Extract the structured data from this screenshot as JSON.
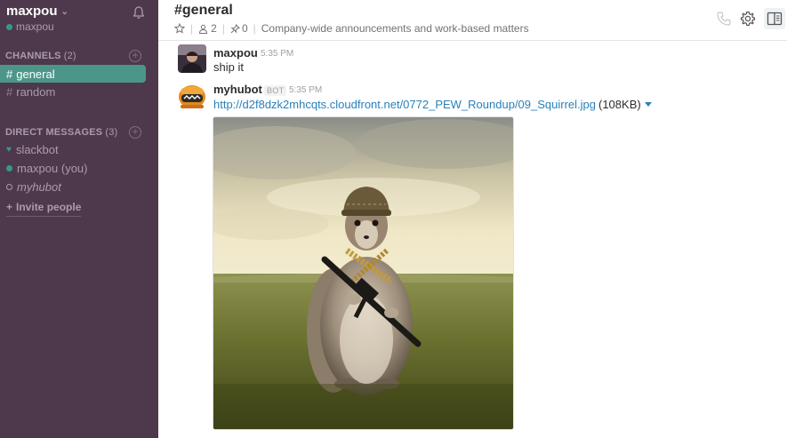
{
  "team": {
    "name": "maxpou",
    "user": "maxpou"
  },
  "channels": {
    "heading": "CHANNELS",
    "count": "(2)",
    "items": [
      {
        "hash": "#",
        "label": "general",
        "active": true
      },
      {
        "hash": "#",
        "label": "random",
        "active": false
      }
    ]
  },
  "direct_messages": {
    "heading": "DIRECT MESSAGES",
    "count": "(3)",
    "items": [
      {
        "label": "slackbot",
        "status": "heart"
      },
      {
        "label": "maxpou (you)",
        "status": "online"
      },
      {
        "label": "myhubot",
        "status": "offline"
      }
    ]
  },
  "invite": {
    "plus": "+",
    "label": "Invite people"
  },
  "header": {
    "title": "#general",
    "members": "2",
    "pinned": "0",
    "purpose": "Company-wide announcements and work-based matters"
  },
  "messages": [
    {
      "sender": "maxpou",
      "time": "5:35 PM",
      "text": "ship it"
    },
    {
      "sender": "myhubot",
      "badge": "BOT",
      "time": "5:35 PM",
      "link": "http://d2f8dzk2mhcqts.cloudfront.net/0772_PEW_Roundup/09_Squirrel.jpg",
      "size": "(108KB)"
    }
  ],
  "colors": {
    "sidebar_bg": "#4d394b",
    "active_channel": "#4c9689",
    "presence": "#38978d",
    "link": "#2a80b9"
  }
}
